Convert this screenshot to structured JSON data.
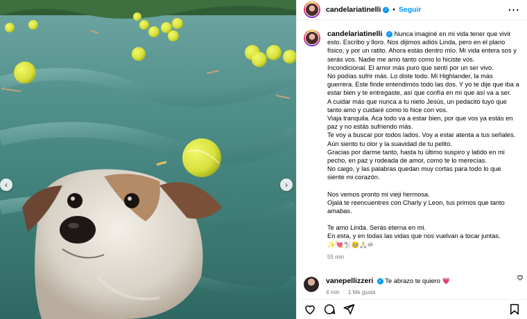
{
  "post": {
    "username": "candelariatinelli",
    "follow_label": "Seguir",
    "separator": "•",
    "more_label": "···"
  },
  "caption": {
    "username": "candelariatinelli",
    "lines": [
      "Nunca imaginé en mi vida tener que vivir esto. Escribo y lloro. Nos dijimos adiós Linda, pero en el plano físico, y por un ratito. Ahora estás dentro mío. Mi vida entera sos y serás vos. Nadie me amo tanto como lo hiciste vos.",
      "Incondicional. El amor más puro que sentí por un ser vivo.",
      "No podías sufrir más. Lo diste todo. Mi Highlander, la más guerrera. Este finde entendimos todo las dos. Y yo te dije que iba a estar bien y te entregaste, así que confía en mí que así va a ser.",
      "A cuidar más que nunca a tu nieto Jesús, un pedacito tuyo que tanto amo y cuidaré como lo hice con vos.",
      "Viaja tranquila. Aca todo va a estar bien, por que vos ya estás en paz y no estás sufriendo más.",
      "Te voy a buscar por todos lados. Voy a estar atenta a tus señales.",
      "Aún siento tu olor y la suavidad de tu pelito.",
      "Gracias por darme tanto, hasta tu último suspiro y latido en mi pecho, en paz y rodeada de amor, como te lo merecías.",
      "No caigo, y las palabras quedan muy cortas para todo lo que siente mi corazón."
    ],
    "lines2": [
      "Nos vemos pronto mi vieji hermosa.",
      "Ojalá te reencuentres con Charly y Leon, tus primos que tanto amabas."
    ],
    "lines3": [
      "Te amo Linda. Serás eterna en mi.",
      "En esta, y en todas las vidas que nos vuelvan a tocar juntas."
    ],
    "emojis": "✨💘🐩🥹🙏🏻♾",
    "time": "55 min"
  },
  "comment": {
    "username": "vanepellizzeri",
    "text": "Te abrazo te quiero",
    "emoji": "💗",
    "time": "4 min",
    "likes": "1 Me gusta"
  },
  "icons": {
    "like": "heart-icon",
    "comment": "comment-icon",
    "share": "share-icon",
    "save": "bookmark-icon",
    "prev": "chevron-left-icon",
    "next": "chevron-right-icon"
  },
  "colors": {
    "accent": "#0095f6",
    "muted": "#737373",
    "border": "#efefef",
    "heart": "#ed4956"
  }
}
